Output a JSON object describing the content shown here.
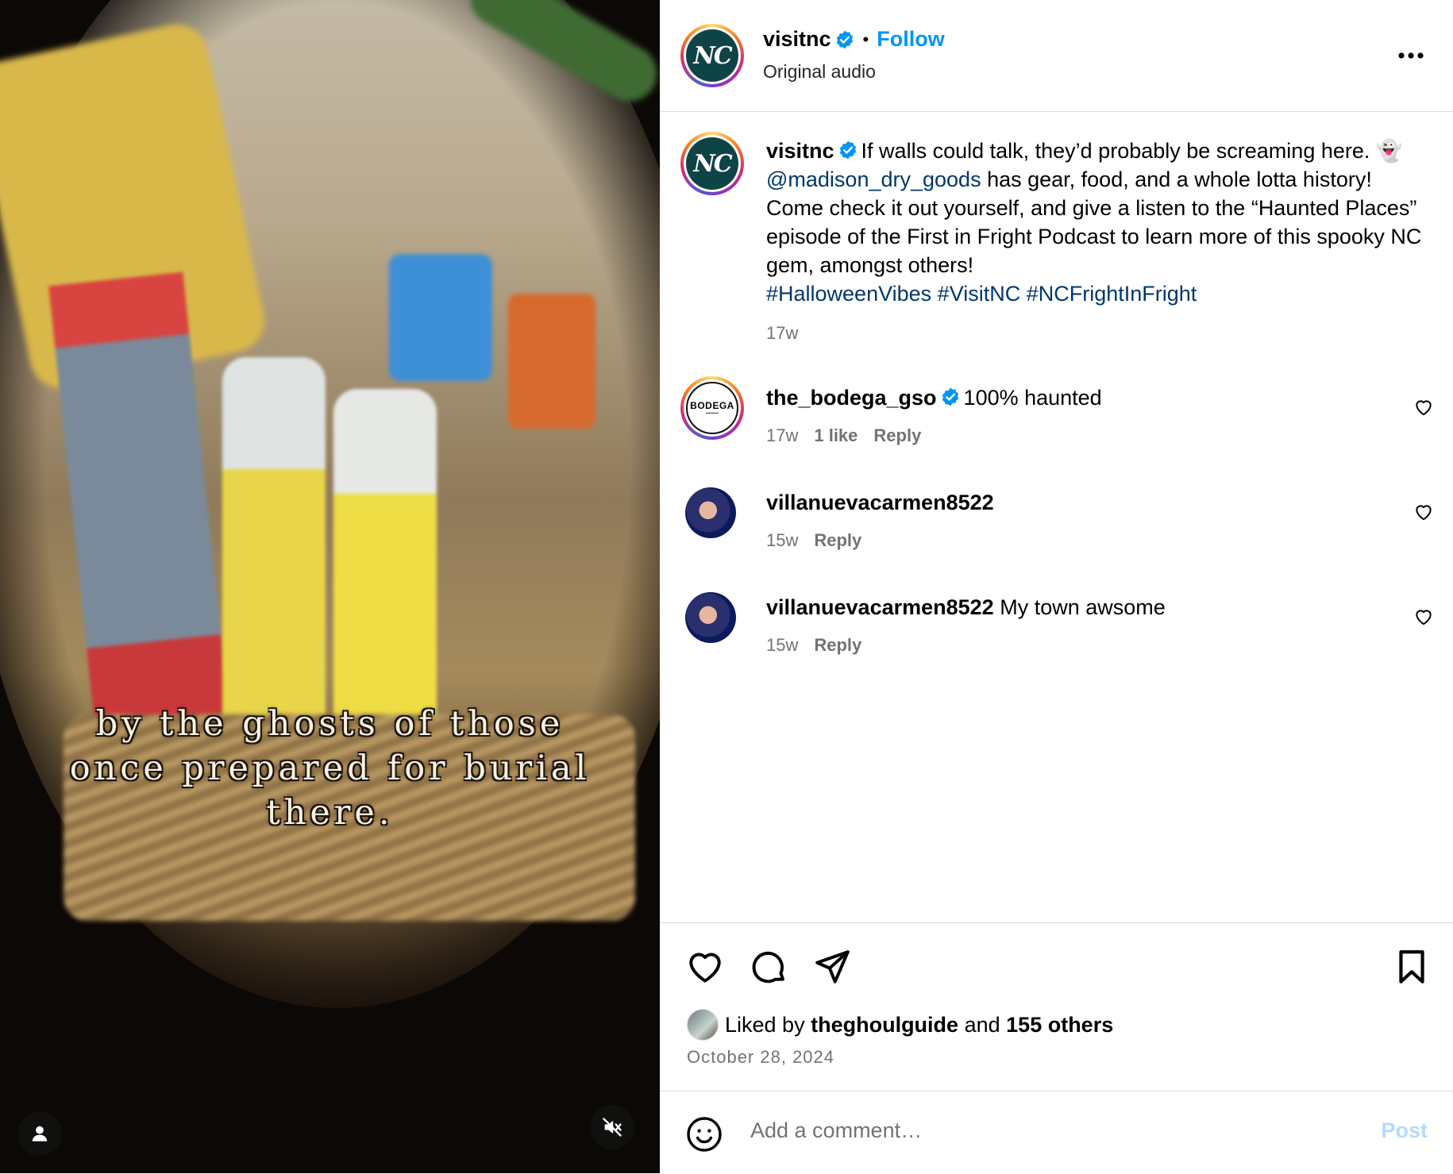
{
  "video": {
    "caption_lines": [
      "by the ghosts of those",
      "once prepared for burial",
      "there."
    ],
    "icons": {
      "user": "user-icon",
      "mute": "muted-speaker-icon"
    }
  },
  "header": {
    "username": "visitnc",
    "separator": "•",
    "follow_label": "Follow",
    "audio_label": "Original audio",
    "more_icon": "more-options-icon"
  },
  "post": {
    "username": "visitnc",
    "caption_start": "If walls could talk, they’d probably be screaming here. ",
    "ghost_emoji": "👻",
    "mention": "@madison_dry_goods",
    "caption_end": " has gear, food, and a whole lotta history! Come check it out yourself, and give a listen to the “Haunted Places” episode of the First in Fright Podcast to learn more of this spooky NC gem, amongst others!",
    "hashtags": [
      "#HalloweenVibes",
      "#VisitNC",
      "#NCFrightInFright"
    ],
    "time": "17w"
  },
  "comments": [
    {
      "username": "the_bodega_gso",
      "verified": true,
      "text": "100% haunted",
      "time": "17w",
      "likes": "1 like",
      "reply": "Reply",
      "avatar_text": "BODEGA"
    },
    {
      "username": "villanuevacarmen8522",
      "verified": false,
      "text": "",
      "time": "15w",
      "likes": "",
      "reply": "Reply"
    },
    {
      "username": "villanuevacarmen8522",
      "verified": false,
      "text": "My town awsome",
      "time": "15w",
      "likes": "",
      "reply": "Reply"
    }
  ],
  "actions": {
    "liked_prefix": "Liked by",
    "liked_user": "theghoulguide",
    "liked_and": "and",
    "liked_others": "155 others",
    "date": "October 28, 2024"
  },
  "composer": {
    "placeholder": "Add a comment…",
    "post_label": "Post"
  },
  "colors": {
    "accent": "#0095f6",
    "link": "#00376b",
    "muted": "#737373",
    "nc_brand": "#0f4447"
  }
}
